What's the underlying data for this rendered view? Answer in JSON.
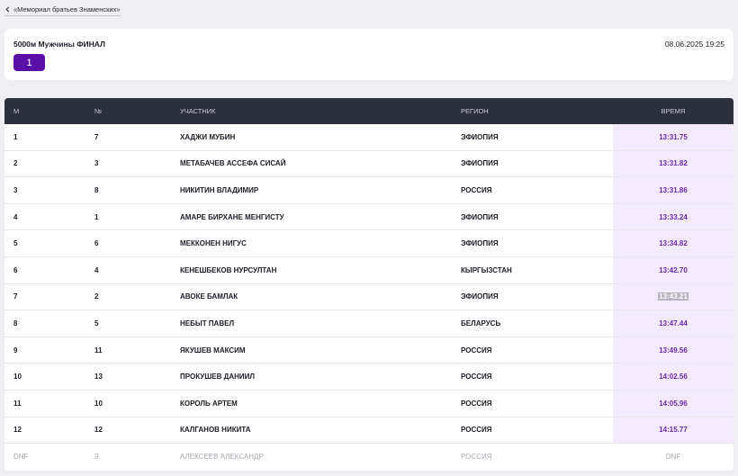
{
  "nav": {
    "back_label": "«Мемориал братьев Знаменских»"
  },
  "event": {
    "title": "5000м Мужчины ФИНАЛ",
    "datetime": "08.06.2025 19:25",
    "heat": "1"
  },
  "table": {
    "headers": {
      "place": "М",
      "number": "№",
      "participant": "УЧАСТНИК",
      "region": "РЕГИОН",
      "time": "ВРЕМЯ"
    },
    "rows": [
      {
        "place": "1",
        "number": "7",
        "name": "ХАДЖИ МУБИН",
        "region": "ЭФИОПИЯ",
        "time": "13:31.75"
      },
      {
        "place": "2",
        "number": "3",
        "name": "МЕТАБАЧЕВ АССЕФА СИСАЙ",
        "region": "ЭФИОПИЯ",
        "time": "13:31.82"
      },
      {
        "place": "3",
        "number": "8",
        "name": "НИКИТИН ВЛАДИМИР",
        "region": "РОССИЯ",
        "time": "13:31.86"
      },
      {
        "place": "4",
        "number": "1",
        "name": "АМАРЕ БИРХАНЕ МЕНГИСТУ",
        "region": "ЭФИОПИЯ",
        "time": "13:33.24"
      },
      {
        "place": "5",
        "number": "6",
        "name": "МЕККОНЕН НИГУС",
        "region": "ЭФИОПИЯ",
        "time": "13:34.82"
      },
      {
        "place": "6",
        "number": "4",
        "name": "КЕНЕШБЕКОВ НУРСУЛТАН",
        "region": "КЫРГЫЗСТАН",
        "time": "13:42.70"
      },
      {
        "place": "7",
        "number": "2",
        "name": "АВОКЕ БАМЛАК",
        "region": "ЭФИОПИЯ",
        "time": "13:43.21"
      },
      {
        "place": "8",
        "number": "5",
        "name": "НЕБЫТ ПАВЕЛ",
        "region": "БЕЛАРУСЬ",
        "time": "13:47.44"
      },
      {
        "place": "9",
        "number": "11",
        "name": "ЯКУШЕВ МАКСИМ",
        "region": "РОССИЯ",
        "time": "13:49.56"
      },
      {
        "place": "10",
        "number": "13",
        "name": "ПРОКУШЕВ ДАНИИЛ",
        "region": "РОССИЯ",
        "time": "14:02.56"
      },
      {
        "place": "11",
        "number": "10",
        "name": "КОРОЛЬ АРТЕМ",
        "region": "РОССИЯ",
        "time": "14:05.96"
      },
      {
        "place": "12",
        "number": "12",
        "name": "КАЛГАНОВ НИКИТА",
        "region": "РОССИЯ",
        "time": "14:15.77"
      },
      {
        "place": "DNF",
        "number": "9",
        "name": "АЛЕКСЕЕВ АЛЕКСАНДР",
        "region": "РОССИЯ",
        "time": "DNF"
      }
    ]
  },
  "colors": {
    "accent": "#5a0fa7",
    "header_bg": "#2c2f3c",
    "time_cell_bg": "#f3ebfd",
    "time_text": "#6a2ba8"
  },
  "icons": {
    "back": "chevron-left-icon"
  }
}
